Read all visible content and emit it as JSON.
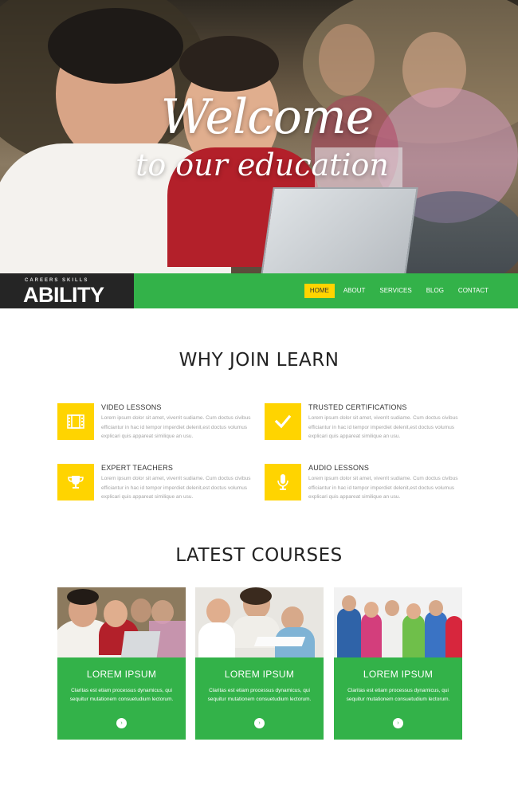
{
  "hero": {
    "title": "Welcome",
    "subtitle": "to our education"
  },
  "brand": {
    "tagline": "CAREERS SKILLS",
    "name": "ABILITY"
  },
  "nav": {
    "items": [
      {
        "label": "HOME",
        "active": true
      },
      {
        "label": "ABOUT",
        "active": false
      },
      {
        "label": "SERVICES",
        "active": false
      },
      {
        "label": "BLOG",
        "active": false
      },
      {
        "label": "CONTACT",
        "active": false
      }
    ]
  },
  "why": {
    "title": "WHY JOIN LEARN",
    "features": [
      {
        "icon": "film-icon",
        "heading": "VIDEO LESSONS",
        "text": "Lorem ipsum dolor sit amet, viverrit sudiame. Cum doctus civibus efficiantur in hac id tempor imperdiet delenit,est doctus volumus explicari quis appareat similique an usu."
      },
      {
        "icon": "checkmark-icon",
        "heading": "TRUSTED CERTIFICATIONS",
        "text": "Lorem ipsum dolor sit amet, viverrit sudiame. Cum doctus civibus efficiantur in hac id tempor imperdiet delenit,est doctus volumus explicari quis appareat similique an usu."
      },
      {
        "icon": "trophy-icon",
        "heading": "EXPERT TEACHERS",
        "text": "Lorem ipsum dolor sit amet, viverrit sudiame. Cum doctus civibus efficiantur in hac id tempor imperdiet delenit,est doctus volumus explicari quis appareat similique an usu."
      },
      {
        "icon": "microphone-icon",
        "heading": "AUDIO LESSONS",
        "text": "Lorem ipsum dolor sit amet, viverrit sudiame. Cum doctus civibus efficiantur in hac id tempor imperdiet delenit,est doctus volumus explicari quis appareat similique an usu."
      }
    ]
  },
  "courses": {
    "title": "LATEST COURSES",
    "items": [
      {
        "title": "LOREM IPSUM",
        "text": "Claritas est etiam processus dynamicus, qui sequitur mutationem consuetudium lectorum."
      },
      {
        "title": "LOREM IPSUM",
        "text": "Claritas est etiam processus dynamicus, qui sequitur mutationem consuetudium lectorum."
      },
      {
        "title": "LOREM IPSUM",
        "text": "Claritas est etiam processus dynamicus, qui sequitur mutationem consuetudium lectorum."
      }
    ]
  },
  "colors": {
    "green": "#33b249",
    "yellow": "#ffd400",
    "dark": "#252525"
  }
}
